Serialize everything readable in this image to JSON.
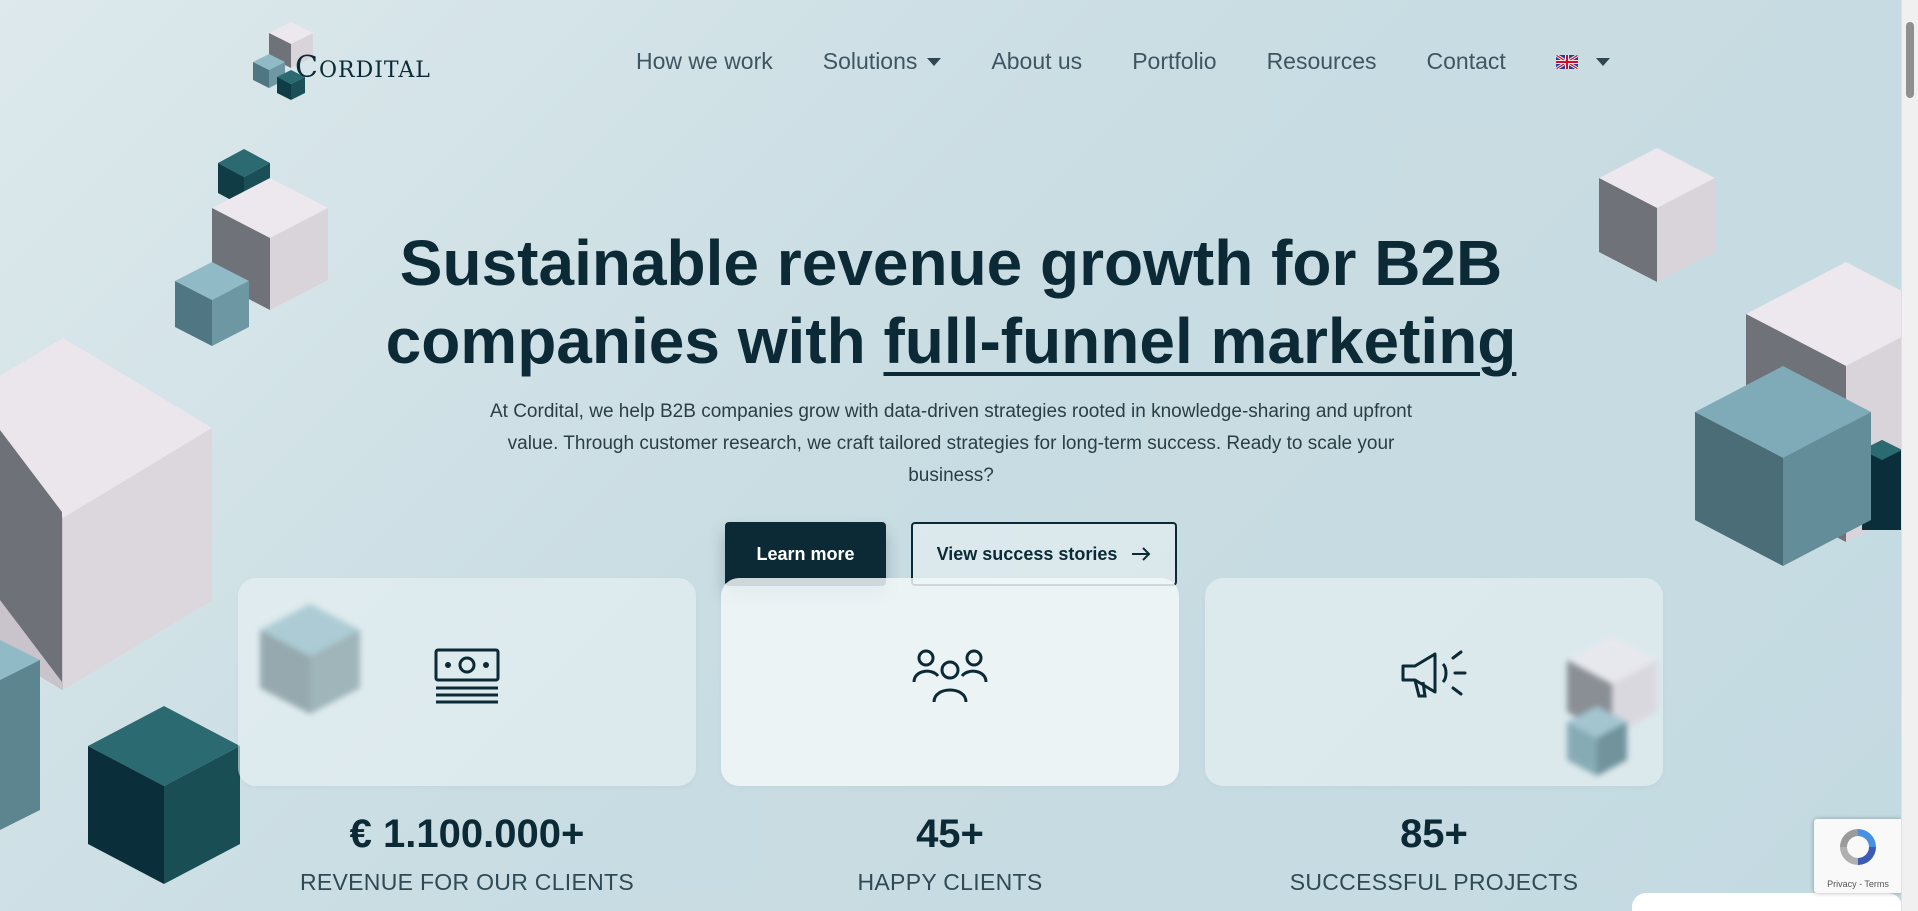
{
  "brand": {
    "name_cap": "C",
    "name_rest": "ORDITAL"
  },
  "nav": {
    "items": [
      {
        "label": "How we work"
      },
      {
        "label": "Solutions"
      },
      {
        "label": "About us"
      },
      {
        "label": "Portfolio"
      },
      {
        "label": "Resources"
      },
      {
        "label": "Contact"
      }
    ],
    "language_icon": "uk-flag-icon"
  },
  "hero": {
    "title_line1": "Sustainable revenue growth for B2B",
    "title_line2_plain": "companies with ",
    "title_line2_underlined": "full-funnel marketing",
    "subtitle": "At Cordital, we help B2B companies grow with data-driven strategies rooted in knowledge-sharing and upfront value. Through customer research, we craft tailored strategies for long-term success. Ready to scale your business?",
    "primary_button": "Learn more",
    "secondary_button": "View success stories"
  },
  "stats": [
    {
      "value": "€ 1.100.000+",
      "label": "REVENUE FOR OUR CLIENTS",
      "icon": "money-icon"
    },
    {
      "value": "45+",
      "label": "HAPPY CLIENTS",
      "icon": "people-icon"
    },
    {
      "value": "85+",
      "label": "SUCCESSFUL PROJECTS",
      "icon": "megaphone-icon"
    }
  ],
  "recaptcha": {
    "text": "Privacy - Terms"
  },
  "colors": {
    "primary": "#0b2a36",
    "background": "#c9dde3",
    "cube_teal": "#7aa9b7",
    "cube_dark": "#14515a",
    "cube_light": "#e4dfe5"
  }
}
